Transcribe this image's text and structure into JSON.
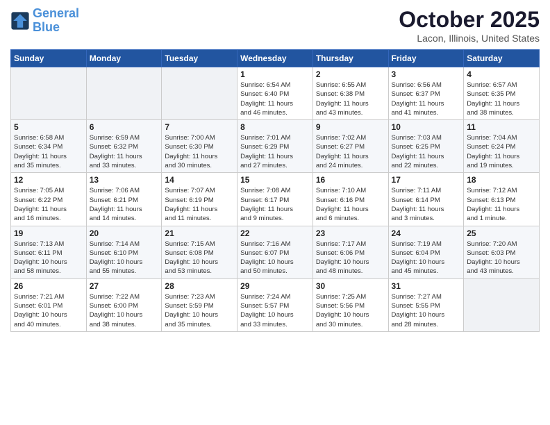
{
  "logo": {
    "line1": "General",
    "line2": "Blue"
  },
  "title": "October 2025",
  "location": "Lacon, Illinois, United States",
  "weekdays": [
    "Sunday",
    "Monday",
    "Tuesday",
    "Wednesday",
    "Thursday",
    "Friday",
    "Saturday"
  ],
  "weeks": [
    [
      {
        "day": "",
        "info": ""
      },
      {
        "day": "",
        "info": ""
      },
      {
        "day": "",
        "info": ""
      },
      {
        "day": "1",
        "info": "Sunrise: 6:54 AM\nSunset: 6:40 PM\nDaylight: 11 hours\nand 46 minutes."
      },
      {
        "day": "2",
        "info": "Sunrise: 6:55 AM\nSunset: 6:38 PM\nDaylight: 11 hours\nand 43 minutes."
      },
      {
        "day": "3",
        "info": "Sunrise: 6:56 AM\nSunset: 6:37 PM\nDaylight: 11 hours\nand 41 minutes."
      },
      {
        "day": "4",
        "info": "Sunrise: 6:57 AM\nSunset: 6:35 PM\nDaylight: 11 hours\nand 38 minutes."
      }
    ],
    [
      {
        "day": "5",
        "info": "Sunrise: 6:58 AM\nSunset: 6:34 PM\nDaylight: 11 hours\nand 35 minutes."
      },
      {
        "day": "6",
        "info": "Sunrise: 6:59 AM\nSunset: 6:32 PM\nDaylight: 11 hours\nand 33 minutes."
      },
      {
        "day": "7",
        "info": "Sunrise: 7:00 AM\nSunset: 6:30 PM\nDaylight: 11 hours\nand 30 minutes."
      },
      {
        "day": "8",
        "info": "Sunrise: 7:01 AM\nSunset: 6:29 PM\nDaylight: 11 hours\nand 27 minutes."
      },
      {
        "day": "9",
        "info": "Sunrise: 7:02 AM\nSunset: 6:27 PM\nDaylight: 11 hours\nand 24 minutes."
      },
      {
        "day": "10",
        "info": "Sunrise: 7:03 AM\nSunset: 6:25 PM\nDaylight: 11 hours\nand 22 minutes."
      },
      {
        "day": "11",
        "info": "Sunrise: 7:04 AM\nSunset: 6:24 PM\nDaylight: 11 hours\nand 19 minutes."
      }
    ],
    [
      {
        "day": "12",
        "info": "Sunrise: 7:05 AM\nSunset: 6:22 PM\nDaylight: 11 hours\nand 16 minutes."
      },
      {
        "day": "13",
        "info": "Sunrise: 7:06 AM\nSunset: 6:21 PM\nDaylight: 11 hours\nand 14 minutes."
      },
      {
        "day": "14",
        "info": "Sunrise: 7:07 AM\nSunset: 6:19 PM\nDaylight: 11 hours\nand 11 minutes."
      },
      {
        "day": "15",
        "info": "Sunrise: 7:08 AM\nSunset: 6:17 PM\nDaylight: 11 hours\nand 9 minutes."
      },
      {
        "day": "16",
        "info": "Sunrise: 7:10 AM\nSunset: 6:16 PM\nDaylight: 11 hours\nand 6 minutes."
      },
      {
        "day": "17",
        "info": "Sunrise: 7:11 AM\nSunset: 6:14 PM\nDaylight: 11 hours\nand 3 minutes."
      },
      {
        "day": "18",
        "info": "Sunrise: 7:12 AM\nSunset: 6:13 PM\nDaylight: 11 hours\nand 1 minute."
      }
    ],
    [
      {
        "day": "19",
        "info": "Sunrise: 7:13 AM\nSunset: 6:11 PM\nDaylight: 10 hours\nand 58 minutes."
      },
      {
        "day": "20",
        "info": "Sunrise: 7:14 AM\nSunset: 6:10 PM\nDaylight: 10 hours\nand 55 minutes."
      },
      {
        "day": "21",
        "info": "Sunrise: 7:15 AM\nSunset: 6:08 PM\nDaylight: 10 hours\nand 53 minutes."
      },
      {
        "day": "22",
        "info": "Sunrise: 7:16 AM\nSunset: 6:07 PM\nDaylight: 10 hours\nand 50 minutes."
      },
      {
        "day": "23",
        "info": "Sunrise: 7:17 AM\nSunset: 6:06 PM\nDaylight: 10 hours\nand 48 minutes."
      },
      {
        "day": "24",
        "info": "Sunrise: 7:19 AM\nSunset: 6:04 PM\nDaylight: 10 hours\nand 45 minutes."
      },
      {
        "day": "25",
        "info": "Sunrise: 7:20 AM\nSunset: 6:03 PM\nDaylight: 10 hours\nand 43 minutes."
      }
    ],
    [
      {
        "day": "26",
        "info": "Sunrise: 7:21 AM\nSunset: 6:01 PM\nDaylight: 10 hours\nand 40 minutes."
      },
      {
        "day": "27",
        "info": "Sunrise: 7:22 AM\nSunset: 6:00 PM\nDaylight: 10 hours\nand 38 minutes."
      },
      {
        "day": "28",
        "info": "Sunrise: 7:23 AM\nSunset: 5:59 PM\nDaylight: 10 hours\nand 35 minutes."
      },
      {
        "day": "29",
        "info": "Sunrise: 7:24 AM\nSunset: 5:57 PM\nDaylight: 10 hours\nand 33 minutes."
      },
      {
        "day": "30",
        "info": "Sunrise: 7:25 AM\nSunset: 5:56 PM\nDaylight: 10 hours\nand 30 minutes."
      },
      {
        "day": "31",
        "info": "Sunrise: 7:27 AM\nSunset: 5:55 PM\nDaylight: 10 hours\nand 28 minutes."
      },
      {
        "day": "",
        "info": ""
      }
    ]
  ]
}
